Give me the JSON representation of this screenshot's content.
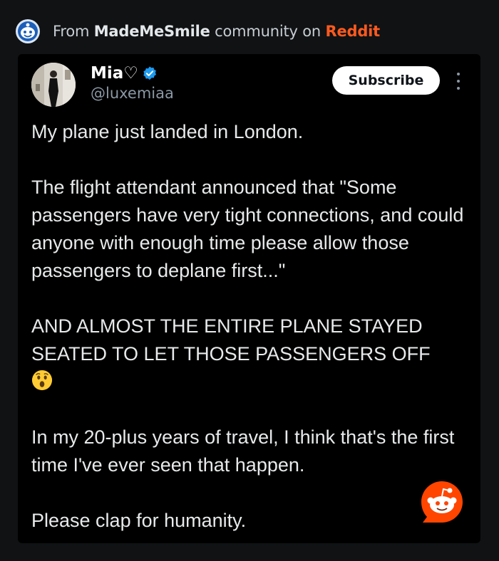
{
  "header": {
    "prefix": "From ",
    "community": "MadeMeSmile",
    "middle": " community on ",
    "platform": "Reddit",
    "logo_icon": "mademesmile-community-icon"
  },
  "post": {
    "author": {
      "name": "Mia♡",
      "handle": "@luxemiaa",
      "verified_icon": "verified-badge-icon",
      "avatar": "avatar"
    },
    "subscribe_label": "Subscribe",
    "paragraphs": {
      "p1": "My plane just landed in London.",
      "p2": "The flight attendant announced that \"Some passengers have very tight connections, and could anyone with enough time please allow those passengers to deplane first...\"",
      "p3": "AND ALMOST THE ENTIRE PLANE STAYED SEATED TO LET THOSE PASSENGERS OFF",
      "p3_emoji": "astonished-face-emoji",
      "p4": "In my 20-plus years of travel, I think that's the first time I've ever seen that happen.",
      "p5": "Please clap for humanity."
    }
  },
  "colors": {
    "background": "#101214",
    "card": "#000000",
    "reddit_orange": "#ff4500",
    "verified_blue": "#1d9bf0",
    "secondary_text": "#8b98a5"
  }
}
